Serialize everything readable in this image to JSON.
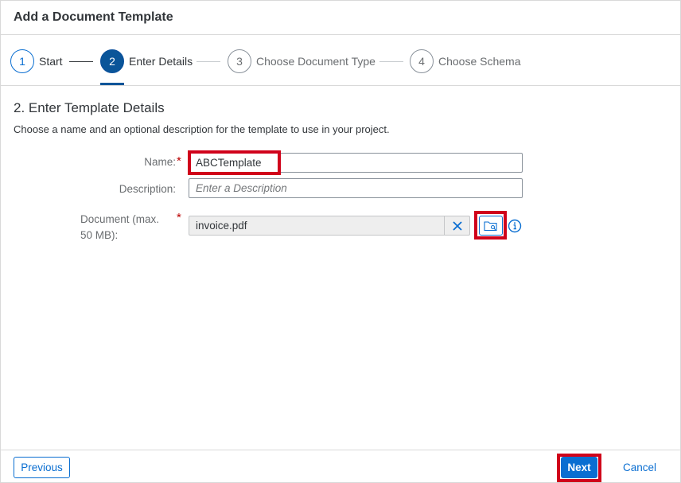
{
  "dialog": {
    "title": "Add a Document Template"
  },
  "wizard": {
    "steps": [
      {
        "number": "1",
        "label": "Start",
        "state": "done"
      },
      {
        "number": "2",
        "label": "Enter Details",
        "state": "active"
      },
      {
        "number": "3",
        "label": "Choose Document Type",
        "state": "upcoming"
      },
      {
        "number": "4",
        "label": "Choose Schema",
        "state": "upcoming"
      }
    ]
  },
  "section": {
    "title": "2. Enter Template Details",
    "description": "Choose a name and an optional description for the template to use in your project."
  },
  "form": {
    "name_label": "Name:",
    "name_value": "ABCTemplate",
    "description_label": "Description:",
    "description_placeholder": "Enter a Description",
    "document_label_line1": "Document (max.",
    "document_label_line2": "50 MB):",
    "document_value": "invoice.pdf",
    "required_marker": "*"
  },
  "footer": {
    "previous_label": "Previous",
    "next_label": "Next",
    "cancel_label": "Cancel"
  },
  "colors": {
    "accent": "#0a6ed1",
    "active_step": "#0a5599",
    "required": "#bb0000",
    "highlight": "#d0021b"
  },
  "icons": {
    "clear": "close-icon",
    "browse": "folder-search-icon",
    "info": "info-icon"
  }
}
